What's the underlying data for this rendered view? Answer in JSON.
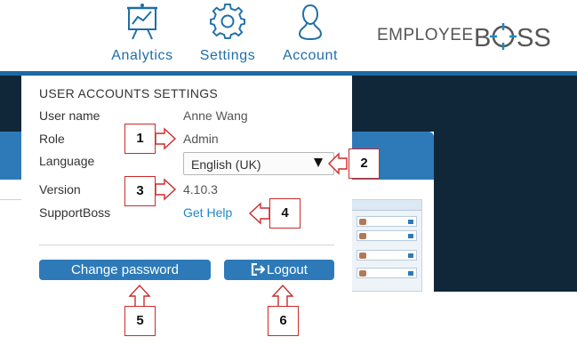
{
  "nav": {
    "analytics_label": "Analytics",
    "settings_label": "Settings",
    "account_label": "Account"
  },
  "logo": {
    "part1": "EMPLOYEE",
    "part2": "BSS"
  },
  "dropdown": {
    "title": "USER ACCOUNTS SETTINGS",
    "username_label": "User name",
    "username_value": "Anne Wang",
    "role_label": "Role",
    "role_value": "Admin",
    "language_label": "Language",
    "language_value": "English (UK)",
    "version_label": "Version",
    "version_value": "4.10.3",
    "support_label": "SupportBoss",
    "support_link": "Get Help",
    "change_password_label": "Change password",
    "logout_label": "Logout"
  },
  "callouts": [
    "1",
    "2",
    "3",
    "4",
    "5",
    "6"
  ],
  "colors": {
    "accent": "#1e6fa8",
    "button": "#2e7ab8",
    "link": "#1e88c8",
    "callout_border": "#cc2a2a",
    "backdrop": "#0f2738"
  },
  "icons": {
    "analytics": "presentation-chart-icon",
    "settings": "gear-icon",
    "account": "person-icon",
    "logout": "logout-icon"
  }
}
